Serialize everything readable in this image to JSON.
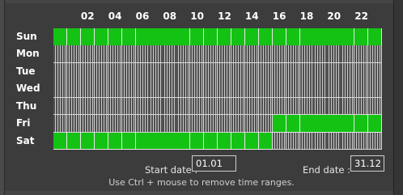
{
  "hours": [
    "02",
    "04",
    "06",
    "08",
    "10",
    "12",
    "14",
    "16",
    "18",
    "20",
    "22"
  ],
  "days": [
    "Sun",
    "Mon",
    "Tue",
    "Wed",
    "Thu",
    "Fri",
    "Sat"
  ],
  "schedule": [
    [
      1,
      1,
      1,
      1,
      1,
      1,
      1,
      1,
      1,
      1,
      1,
      1,
      1,
      1,
      1,
      1,
      1,
      1,
      1,
      1,
      1,
      1,
      1,
      1
    ],
    [
      0,
      0,
      0,
      0,
      0,
      0,
      0,
      0,
      0,
      0,
      0,
      0,
      0,
      0,
      0,
      0,
      0,
      0,
      0,
      0,
      0,
      0,
      0,
      0
    ],
    [
      0,
      0,
      0,
      0,
      0,
      0,
      0,
      0,
      0,
      0,
      0,
      0,
      0,
      0,
      0,
      0,
      0,
      0,
      0,
      0,
      0,
      0,
      0,
      0
    ],
    [
      0,
      0,
      0,
      0,
      0,
      0,
      0,
      0,
      0,
      0,
      0,
      0,
      0,
      0,
      0,
      0,
      0,
      0,
      0,
      0,
      0,
      0,
      0,
      0
    ],
    [
      0,
      0,
      0,
      0,
      0,
      0,
      0,
      0,
      0,
      0,
      0,
      0,
      0,
      0,
      0,
      0,
      0,
      0,
      0,
      0,
      0,
      0,
      0,
      0
    ],
    [
      0,
      0,
      0,
      0,
      0,
      0,
      0,
      0,
      0,
      0,
      0,
      0,
      0,
      0,
      0,
      0,
      1,
      1,
      1,
      1,
      1,
      1,
      1,
      1
    ],
    [
      1,
      1,
      1,
      1,
      1,
      1,
      1,
      1,
      1,
      1,
      1,
      1,
      1,
      1,
      1,
      1,
      0,
      0,
      0,
      0,
      0,
      0,
      0,
      0
    ]
  ],
  "start_date": {
    "label": "Start date :",
    "value": "01.01"
  },
  "end_date": {
    "label": "End date :",
    "value": "31.12"
  },
  "hint": "Use Ctrl + mouse to remove time ranges.",
  "colors": {
    "active": "#14c214",
    "inactive": "#505050",
    "background": "#3c3c3c"
  }
}
